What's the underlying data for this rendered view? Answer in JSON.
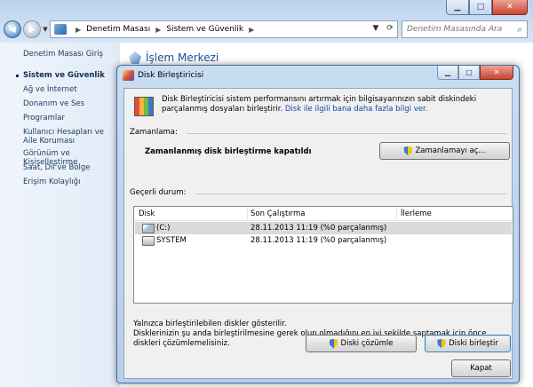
{
  "window": {
    "address_crumbs": [
      "Denetim Masası",
      "Sistem ve Güvenlik"
    ],
    "search_placeholder": "Denetim Masasında Ara",
    "caption_buttons": {
      "minimize": "▁",
      "maximize": "□",
      "close": "✕"
    }
  },
  "sidebar": {
    "items": [
      {
        "label": "Denetim Masası Giriş"
      },
      {
        "label": "Sistem ve Güvenlik",
        "current": true
      },
      {
        "label": "Ağ ve İnternet"
      },
      {
        "label": "Donanım ve Ses"
      },
      {
        "label": "Programlar"
      },
      {
        "label": "Kullanıcı Hesapları ve Aile Koruması"
      },
      {
        "label": "Görünüm ve Kişiselleştirme"
      },
      {
        "label": "Saat, Dil ve Bölge"
      },
      {
        "label": "Erişim Kolaylığı"
      }
    ]
  },
  "main": {
    "header": "İşlem Merkezi"
  },
  "dialog": {
    "title": "Disk Birleştiricisi",
    "intro_text": "Disk Birleştiricisi sistem performansını artırmak için bilgisayarınızın sabit diskindeki parçalanmış dosyaları birleştirir. ",
    "intro_link": "Disk ile ilgili bana daha fazla bilgi ver.",
    "schedule_label": "Zamanlama:",
    "schedule_status": "Zamanlanmış disk birleştirme kapatıldı",
    "schedule_button": "Zamanlamayı aç...",
    "current_status_label": "Geçerli durum:",
    "columns": [
      "Disk",
      "Son Çalıştırma",
      "İlerleme"
    ],
    "disks": [
      {
        "name": "(C:)",
        "last_run": "28.11.2013 11:19 (%0 parçalanmış)",
        "progress": "",
        "selected": true,
        "icon": "windows-drive-icon"
      },
      {
        "name": "SYSTEM",
        "last_run": "28.11.2013 11:19 (%0 parçalanmış)",
        "progress": "",
        "selected": false,
        "icon": "hard-drive-icon"
      }
    ],
    "note_line1": "Yalnızca birleştirilebilen diskler gösterilir.",
    "note_line2": "Disklerinizin şu anda birleştirilmesine gerek olup olmadığını en iyi şekilde saptamak için önce diskleri çözümlemelisiniz.",
    "analyze_button": "Diski çözümle",
    "defrag_button": "Diski birleştir",
    "close_button": "Kapat"
  },
  "colors": {
    "link": "#0a47b3",
    "header": "#1e4fa0",
    "sidebar_text": "#1e3a5f"
  }
}
